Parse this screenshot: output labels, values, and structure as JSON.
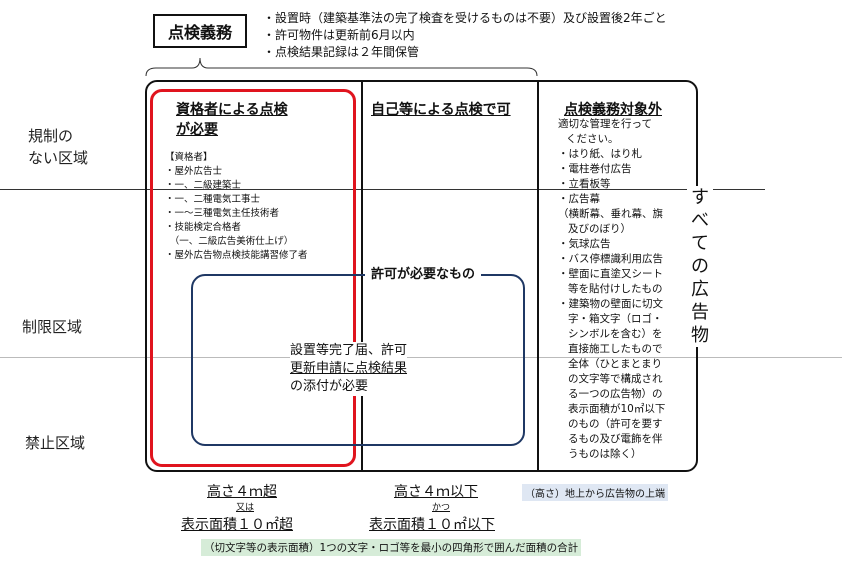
{
  "title": "点検義務",
  "notes": [
    "・設置時（建築基準法の完了検査を受けるものは不要）及び設置後2年ごと",
    "・許可物件は更新前6月以内",
    "・点検結果記録は２年間保管"
  ],
  "zones": {
    "unregulated_line1": "規制の",
    "unregulated_line2": "ない区域",
    "restricted": "制限区域",
    "prohibited": "禁止区域"
  },
  "col1": {
    "heading_line1": "資格者による点検",
    "heading_line2": "が必要",
    "qual_title": "【資格者】",
    "qual_items": [
      "・屋外広告士",
      "・一、二級建築士",
      "・一、二種電気工事士",
      "・一～三種電気主任技術者",
      "・技能検定合格者",
      "　（一、二級広告美術仕上げ）",
      "・屋外広告物点検技能講習修了者"
    ]
  },
  "col2": {
    "heading": "自己等による点検で可"
  },
  "permit": {
    "label": "許可が必要なもの",
    "text_line1": "設置等完了届、許可",
    "text_line2": "更新申請に点検結果",
    "text_line3": "の添付が必要"
  },
  "col3": {
    "heading": "点検義務対象外",
    "lines": [
      "適切な管理を行って",
      "ください。",
      "・はり紙、はり札",
      "・電柱巻付広告",
      "・立看板等",
      "・広告幕",
      "（横断幕、垂れ幕、旗",
      "及びのぼり）",
      "・気球広告",
      "・バス停標識利用広告",
      "・壁面に直塗又シート",
      "等を貼付けしたもの",
      "・建築物の壁面に切文",
      "字・箱文字（ロゴ・",
      "シンボルを含む）を",
      "直接施工したもので",
      "全体（ひとまとまり",
      "の文字等で構成され",
      "る一つの広告物）の",
      "表示面積が10㎡以下",
      "のもの（許可を要す",
      "るもの及び電飾を伴",
      "うものは除く）"
    ]
  },
  "vertical_label": "すべての広告物",
  "bottom": {
    "left_height": "高さ４ｍ超",
    "left_or": "又は",
    "left_area": "表示面積１０㎡超",
    "mid_height": "高さ４ｍ以下",
    "mid_and": "かつ",
    "mid_area": "表示面積１０㎡以下",
    "height_note": "（高さ）地上から広告物の上端",
    "area_note": "（切文字等の表示面積）1つの文字・ロゴ等を最小の四角形で囲んだ面積の合計"
  }
}
